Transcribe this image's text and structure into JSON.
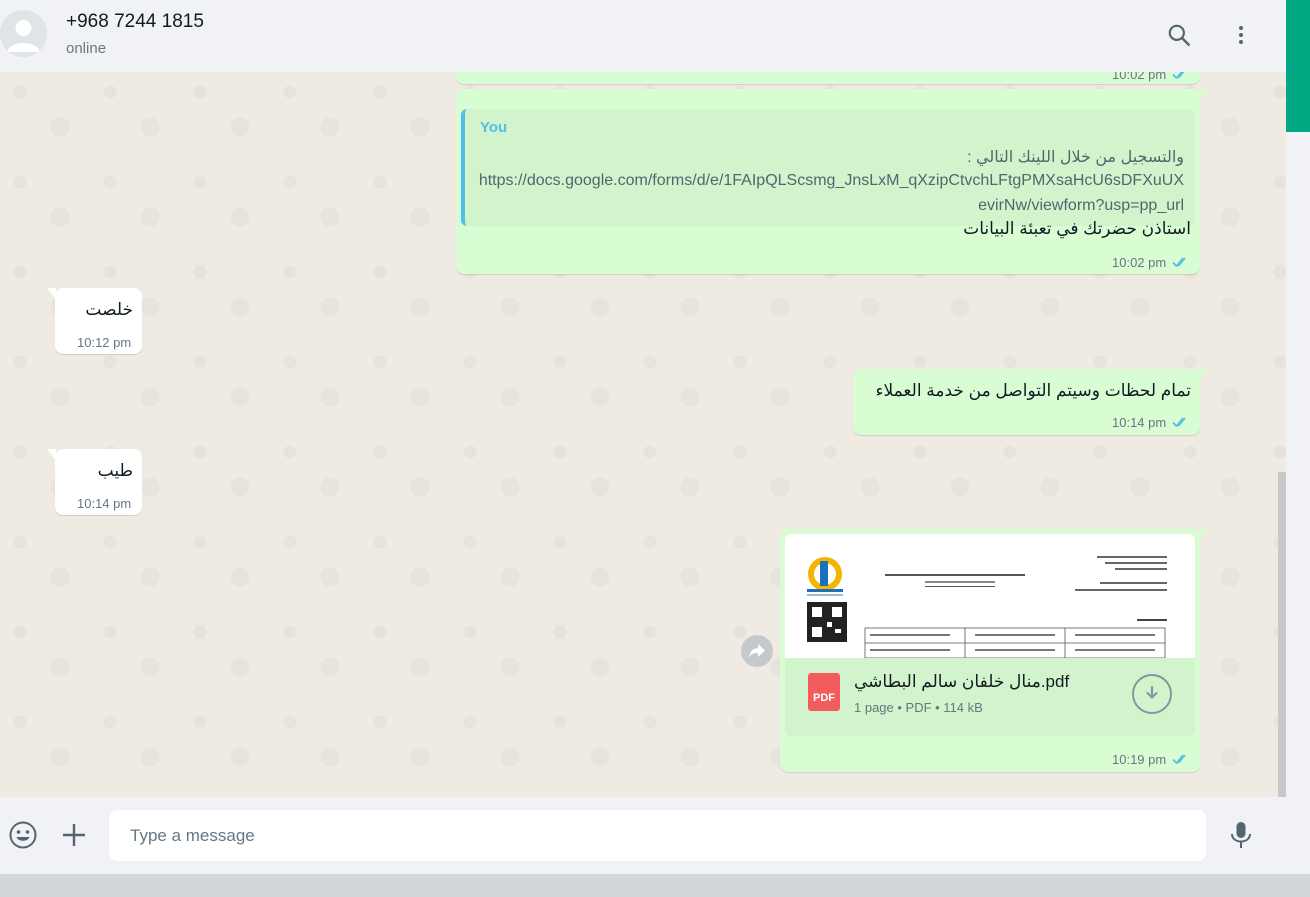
{
  "header": {
    "contact_name": "+968 7244 1815",
    "contact_status": "online",
    "search_icon": "search-icon",
    "menu_icon": "kebab-menu-icon"
  },
  "colors": {
    "accent": "#00a884",
    "outgoing_bubble": "#d9fdd3",
    "incoming_bubble": "#ffffff",
    "quote_bar": "#53bdeb",
    "read_ticks": "#53bdeb",
    "chat_bg": "#efeae2"
  },
  "messages": [
    {
      "id": "m0",
      "direction": "out",
      "time": "10:02 pm",
      "status": "read"
    },
    {
      "id": "m1",
      "direction": "out",
      "quote": {
        "author": "You",
        "line1": "والتسجيل من خلال اللينك التالي :",
        "line2": "https://docs.google.com/forms/d/e/1FAIpQLScsmg_JnsLxM_qXzipCtvchLFtgPMXsaHcU6sDFXuUX",
        "line3": "evirNw/viewform?usp=pp_url"
      },
      "text": "استاذن حضرتك في تعبئة البيانات",
      "time": "10:02 pm",
      "status": "read"
    },
    {
      "id": "m2",
      "direction": "in",
      "text": "خلصت",
      "time": "10:12 pm"
    },
    {
      "id": "m3",
      "direction": "out",
      "text": "تمام لحظات وسيتم التواصل من خدمة العملاء",
      "time": "10:14 pm",
      "status": "read"
    },
    {
      "id": "m4",
      "direction": "in",
      "text": "طيب",
      "time": "10:14 pm"
    },
    {
      "id": "m5",
      "direction": "out",
      "document": {
        "badge": "PDF",
        "name": "منال خلفان سالم البطاشي.pdf",
        "meta": "1 page • PDF • 114 kB"
      },
      "time": "10:19 pm",
      "status": "read"
    }
  ],
  "composer": {
    "placeholder": "Type a message",
    "emoji_icon": "emoji-icon",
    "attach_icon": "plus-icon",
    "mic_icon": "microphone-icon"
  }
}
